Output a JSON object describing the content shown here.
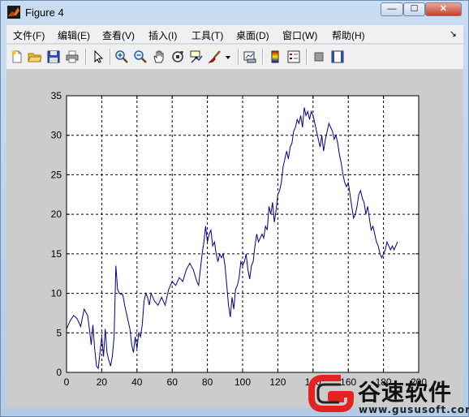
{
  "window": {
    "title": "Figure 4",
    "buttons": {
      "minimize": "—",
      "maximize": "☐",
      "close": "✕"
    }
  },
  "menu": {
    "items": [
      "文件(F)",
      "编辑(E)",
      "查看(V)",
      "插入(I)",
      "工具(T)",
      "桌面(D)",
      "窗口(W)",
      "帮助(H)"
    ],
    "overflow": "↘"
  },
  "toolbar": {
    "icons": [
      "new-figure-icon",
      "open-file-icon",
      "save-icon",
      "print-icon",
      "pointer-icon",
      "zoom-in-icon",
      "zoom-out-icon",
      "pan-hand-icon",
      "rotate-3d-icon",
      "data-cursor-icon",
      "brush-icon",
      "brush-dropdown-icon",
      "link-plot-icon",
      "colorbar-icon",
      "legend-icon",
      "hide-plot-tools-icon",
      "show-plot-tools-icon"
    ]
  },
  "watermark": {
    "title": "谷速软件",
    "url": "www.gususoft.com",
    "colors": {
      "logo_red": "#e52222",
      "logo_dark": "#222222"
    }
  },
  "colors": {
    "line": "#00008b",
    "canvas": "#cccccc",
    "axes_bg": "#ffffff"
  },
  "chart_data": {
    "type": "line",
    "title": "",
    "xlabel": "",
    "ylabel": "",
    "xlim": [
      0,
      200
    ],
    "ylim": [
      0,
      35
    ],
    "xticks": [
      0,
      20,
      40,
      60,
      80,
      100,
      120,
      140,
      160,
      180,
      200
    ],
    "yticks": [
      0,
      5,
      10,
      15,
      20,
      25,
      30,
      35
    ],
    "grid": true,
    "grid_style": "dashed",
    "series": [
      {
        "color": "#00008b",
        "points": [
          [
            0,
            5.5
          ],
          [
            2,
            6.5
          ],
          [
            4,
            7.2
          ],
          [
            6,
            6.8
          ],
          [
            8,
            5.8
          ],
          [
            10,
            8.0
          ],
          [
            12,
            7.2
          ],
          [
            13,
            5.5
          ],
          [
            14,
            3.5
          ],
          [
            15,
            6.0
          ],
          [
            16,
            3.0
          ],
          [
            17,
            0.8
          ],
          [
            18,
            0.5
          ],
          [
            19,
            2.5
          ],
          [
            20,
            4.5
          ],
          [
            21,
            2.0
          ],
          [
            22,
            5.5
          ],
          [
            23,
            2.5
          ],
          [
            24,
            1.5
          ],
          [
            25,
            0.8
          ],
          [
            26,
            2.0
          ],
          [
            27,
            4.5
          ],
          [
            28,
            13.5
          ],
          [
            29,
            10.5
          ],
          [
            30,
            10.0
          ],
          [
            32,
            9.8
          ],
          [
            33,
            8.5
          ],
          [
            34,
            7.5
          ],
          [
            35,
            6.5
          ],
          [
            36,
            5.5
          ],
          [
            37,
            3.5
          ],
          [
            38,
            2.5
          ],
          [
            39,
            4.5
          ],
          [
            40,
            3.0
          ],
          [
            41,
            5.0
          ],
          [
            42,
            4.5
          ],
          [
            43,
            6.0
          ],
          [
            44,
            9.0
          ],
          [
            45,
            10.0
          ],
          [
            46,
            9.5
          ],
          [
            47,
            8.5
          ],
          [
            48,
            10.0
          ],
          [
            50,
            9.0
          ],
          [
            52,
            8.5
          ],
          [
            54,
            9.5
          ],
          [
            56,
            8.5
          ],
          [
            58,
            10.5
          ],
          [
            60,
            11.5
          ],
          [
            62,
            11.0
          ],
          [
            64,
            12.0
          ],
          [
            66,
            11.5
          ],
          [
            68,
            13.0
          ],
          [
            70,
            13.8
          ],
          [
            72,
            13.0
          ],
          [
            74,
            11.5
          ],
          [
            75,
            11.0
          ],
          [
            76,
            13.0
          ],
          [
            77,
            15.0
          ],
          [
            78,
            16.5
          ],
          [
            79,
            18.5
          ],
          [
            80,
            16.5
          ],
          [
            81,
            17.5
          ],
          [
            82,
            18.0
          ],
          [
            83,
            16.0
          ],
          [
            84,
            16.5
          ],
          [
            85,
            15.0
          ],
          [
            86,
            14.0
          ],
          [
            87,
            15.0
          ],
          [
            88,
            14.5
          ],
          [
            89,
            15.0
          ],
          [
            90,
            13.5
          ],
          [
            91,
            11.0
          ],
          [
            92,
            8.5
          ],
          [
            93,
            7.0
          ],
          [
            94,
            9.5
          ],
          [
            95,
            8.0
          ],
          [
            96,
            10.5
          ],
          [
            97,
            11.0
          ],
          [
            98,
            12.0
          ],
          [
            99,
            14.0
          ],
          [
            100,
            13.5
          ],
          [
            101,
            14.0
          ],
          [
            102,
            15.0
          ],
          [
            103,
            13.0
          ],
          [
            104,
            11.8
          ],
          [
            105,
            13.5
          ],
          [
            106,
            14.0
          ],
          [
            107,
            16.0
          ],
          [
            108,
            17.5
          ],
          [
            109,
            16.5
          ],
          [
            110,
            17.0
          ],
          [
            111,
            17.5
          ],
          [
            112,
            17.0
          ],
          [
            113,
            18.5
          ],
          [
            114,
            18.0
          ],
          [
            115,
            21.0
          ],
          [
            116,
            20.0
          ],
          [
            117,
            21.5
          ],
          [
            118,
            19.0
          ],
          [
            119,
            20.5
          ],
          [
            120,
            22.5
          ],
          [
            121,
            23.0
          ],
          [
            122,
            24.0
          ],
          [
            123,
            26.0
          ],
          [
            124,
            27.0
          ],
          [
            125,
            28.0
          ],
          [
            126,
            27.0
          ],
          [
            127,
            28.5
          ],
          [
            128,
            29.0
          ],
          [
            129,
            30.5
          ],
          [
            130,
            31.0
          ],
          [
            131,
            32.0
          ],
          [
            132,
            31.5
          ],
          [
            133,
            32.5
          ],
          [
            134,
            31.0
          ],
          [
            135,
            33.5
          ],
          [
            136,
            32.5
          ],
          [
            137,
            33.0
          ],
          [
            138,
            32.0
          ],
          [
            139,
            33.0
          ],
          [
            140,
            32.5
          ],
          [
            141,
            31.5
          ],
          [
            142,
            30.5
          ],
          [
            143,
            29.5
          ],
          [
            144,
            28.5
          ],
          [
            145,
            30.0
          ],
          [
            146,
            28.0
          ],
          [
            147,
            29.5
          ],
          [
            148,
            30.5
          ],
          [
            149,
            31.5
          ],
          [
            150,
            31.0
          ],
          [
            151,
            30.5
          ],
          [
            152,
            29.5
          ],
          [
            153,
            30.0
          ],
          [
            154,
            29.0
          ],
          [
            155,
            27.5
          ],
          [
            156,
            26.5
          ],
          [
            157,
            25.0
          ],
          [
            158,
            24.0
          ],
          [
            159,
            23.5
          ],
          [
            160,
            24.0
          ],
          [
            161,
            22.5
          ],
          [
            162,
            21.0
          ],
          [
            163,
            19.5
          ],
          [
            164,
            20.0
          ],
          [
            165,
            21.0
          ],
          [
            166,
            22.5
          ],
          [
            167,
            23.0
          ],
          [
            168,
            22.0
          ],
          [
            169,
            21.5
          ],
          [
            170,
            20.0
          ],
          [
            171,
            21.0
          ],
          [
            172,
            19.5
          ],
          [
            173,
            18.0
          ],
          [
            174,
            18.5
          ],
          [
            175,
            17.5
          ],
          [
            176,
            16.5
          ],
          [
            177,
            16.0
          ],
          [
            178,
            15.0
          ],
          [
            179,
            14.5
          ],
          [
            180,
            15.0
          ],
          [
            181,
            15.5
          ],
          [
            182,
            16.5
          ],
          [
            183,
            16.0
          ],
          [
            184,
            15.5
          ],
          [
            185,
            16.0
          ],
          [
            186,
            15.5
          ],
          [
            188,
            16.5
          ]
        ]
      }
    ]
  }
}
